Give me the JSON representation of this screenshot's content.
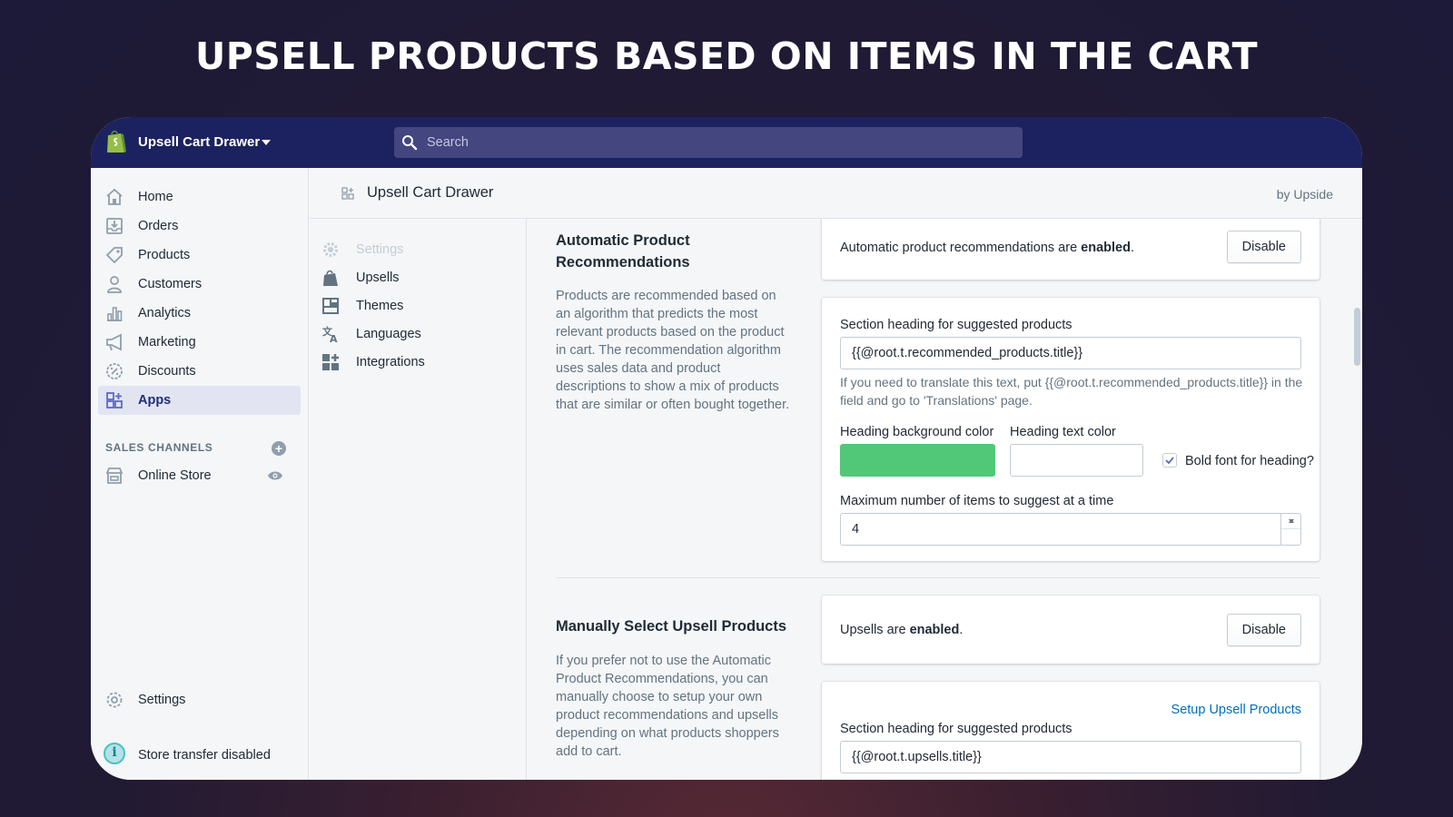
{
  "headline": "UPSELL PRODUCTS BASED ON ITEMS IN THE CART",
  "topbar": {
    "store_name": "Upsell Cart Drawer",
    "search_placeholder": "Search"
  },
  "leftnav": {
    "items": [
      {
        "label": "Home",
        "icon": "home-icon"
      },
      {
        "label": "Orders",
        "icon": "orders-icon"
      },
      {
        "label": "Products",
        "icon": "tag-icon"
      },
      {
        "label": "Customers",
        "icon": "person-icon"
      },
      {
        "label": "Analytics",
        "icon": "bar-chart-icon"
      },
      {
        "label": "Marketing",
        "icon": "megaphone-icon"
      },
      {
        "label": "Discounts",
        "icon": "discount-icon"
      },
      {
        "label": "Apps",
        "icon": "apps-icon",
        "active": true
      }
    ],
    "sales_channels_label": "SALES CHANNELS",
    "online_store_label": "Online Store",
    "settings_label": "Settings",
    "store_transfer_label": "Store transfer disabled"
  },
  "apphead": {
    "title": "Upsell Cart Drawer",
    "by": "by Upside"
  },
  "subnav": {
    "items": [
      {
        "label": "Settings",
        "disabled": true
      },
      {
        "label": "Upsells"
      },
      {
        "label": "Themes"
      },
      {
        "label": "Languages"
      },
      {
        "label": "Integrations"
      }
    ]
  },
  "auto": {
    "title": "Automatic Product Recommendations",
    "description": "Products are recommended based on an algorithm that predicts the most relevant products based on the product in cart. The recommendation algorithm uses sales data and product descriptions to show a mix of products that are similar or often bought together.",
    "status_prefix": "Automatic product recommendations are ",
    "status_word": "enabled",
    "status_suffix": ".",
    "disable_label": "Disable",
    "heading_label": "Section heading for suggested products",
    "heading_value": "{{@root.t.recommended_products.title}}",
    "help_text": "If you need to translate this text, put {{@root.t.recommended_products.title}} in the field and go to 'Translations' page.",
    "bg_color_label": "Heading background color",
    "bg_color": "#50c878",
    "text_color_label": "Heading text color",
    "text_color": "#ffffff",
    "bold_label": "Bold font for heading?",
    "bold_checked": true,
    "max_label": "Maximum number of items to suggest at a time",
    "max_value": "4"
  },
  "manual": {
    "title": "Manually Select Upsell Products",
    "description": "If you prefer not to use the Automatic Product Recommendations, you can manually choose to setup your own product recommendations and upsells depending on what products shoppers add to cart.",
    "status_prefix": "Upsells are ",
    "status_word": "enabled",
    "status_suffix": ".",
    "disable_label": "Disable",
    "setup_link": "Setup Upsell Products",
    "heading_label": "Section heading for suggested products",
    "heading_value": "{{@root.t.upsells.title}}"
  },
  "colors": {
    "topbar": "#1c2260",
    "accent": "#202e78",
    "link": "#006fbb"
  }
}
